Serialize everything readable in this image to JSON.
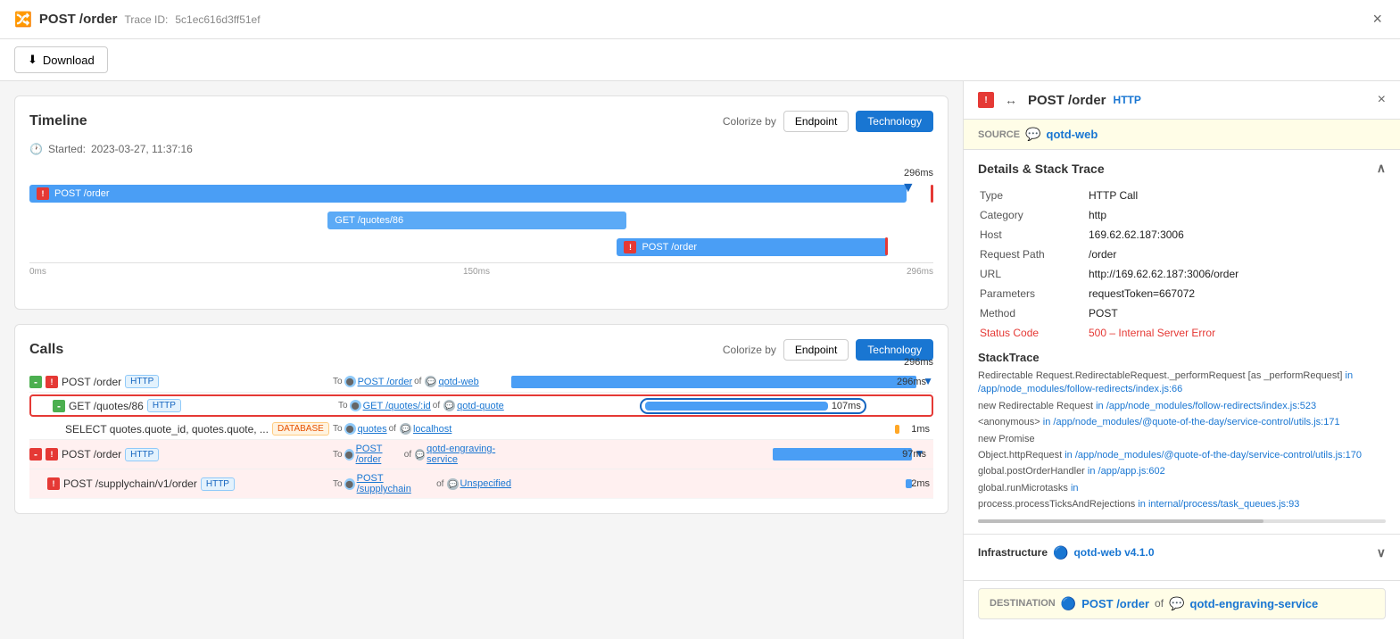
{
  "topbar": {
    "icon": "↔",
    "title": "POST /order",
    "trace_label": "Trace ID:",
    "trace_id": "5c1ec616d3ff51ef",
    "close_label": "×"
  },
  "download": {
    "button_label": "Download",
    "icon": "⬇"
  },
  "timeline": {
    "title": "Timeline",
    "colorize_label": "Colorize by",
    "endpoint_label": "Endpoint",
    "technology_label": "Technology",
    "started_label": "Started:",
    "started_value": "2023-03-27, 11:37:16",
    "end_time": "296ms",
    "bars": [
      {
        "label": "POST /order",
        "start_pct": 0,
        "width_pct": 97,
        "has_error": true,
        "arrow": true
      },
      {
        "label": "GET /quotes/86",
        "start_pct": 32,
        "width_pct": 34,
        "has_error": false,
        "arrow": false
      },
      {
        "label": "POST /order",
        "start_pct": 64,
        "width_pct": 30,
        "has_error": true,
        "arrow": false
      }
    ]
  },
  "calls": {
    "title": "Calls",
    "colorize_label": "Colorize by",
    "endpoint_label": "Endpoint",
    "technology_label": "Technology",
    "end_time": "296ms",
    "rows": [
      {
        "indent": 0,
        "collapse": "minus-green",
        "error": true,
        "name": "POST /order",
        "badge": "HTTP",
        "to": "POST /order",
        "of": "qotd-web",
        "bar_width_pct": 96,
        "bar_offset_pct": 0,
        "bar_color": "blue",
        "duration": "296ms",
        "has_arrow": true
      },
      {
        "indent": 1,
        "collapse": "minus-green",
        "error": false,
        "name": "GET /quotes/86",
        "badge": "HTTP",
        "to": "GET /quotes/:id",
        "of": "qotd-quote",
        "bar_width_pct": 50,
        "bar_offset_pct": 32,
        "bar_color": "blue",
        "duration": "107ms",
        "highlighted": true
      },
      {
        "indent": 2,
        "collapse": null,
        "error": false,
        "name": "SELECT quotes.quote_id, quotes.quote, ...",
        "badge": "DATABASE",
        "to": "quotes",
        "of": "localhost",
        "bar_width_pct": 1,
        "bar_offset_pct": 55,
        "bar_color": "orange",
        "duration": "1ms"
      },
      {
        "indent": 0,
        "collapse": "minus-red",
        "error": true,
        "name": "POST /order",
        "badge": "HTTP",
        "to": "POST /order",
        "of": "qotd-engraving-service",
        "bar_width_pct": 35,
        "bar_offset_pct": 61,
        "bar_color": "blue",
        "duration": "97ms",
        "has_arrow": true
      },
      {
        "indent": 1,
        "collapse": null,
        "error": true,
        "name": "POST /supplychain/v1/order",
        "badge": "HTTP",
        "to": "POST /supplychain",
        "of": "Unspecified",
        "bar_width_pct": 1.5,
        "bar_offset_pct": 95,
        "bar_color": "blue",
        "duration": "2ms"
      }
    ]
  },
  "detail_panel": {
    "error_icon": "!",
    "arrows": "↔",
    "title": "POST /order",
    "badge": "HTTP",
    "close": "×",
    "source_label": "SOURCE",
    "source_icon": "💬",
    "source_value": "qotd-web",
    "section_details_title": "Details & Stack Trace",
    "details": [
      {
        "key": "Type",
        "value": "HTTP Call"
      },
      {
        "key": "Category",
        "value": "http"
      },
      {
        "key": "Host",
        "value": "169.62.62.187:3006"
      },
      {
        "key": "Request Path",
        "value": "/order"
      },
      {
        "key": "URL",
        "value": "http://169.62.62.187:3006/order"
      },
      {
        "key": "Parameters",
        "value": "requestToken=667072"
      },
      {
        "key": "Method",
        "value": "POST"
      },
      {
        "key": "Status Code",
        "value": "500 – Internal Server Error",
        "error": true
      }
    ],
    "stack_trace_title": "StackTrace",
    "stack_lines": [
      {
        "method": "Redirectable Request.RedirectableRequest._performRequest [as _performRequest]",
        "path": "in /app/node_modules/follow-redirects/index.js:66"
      },
      {
        "method": "new RedirectableRequest",
        "path": "in /app/node_modules/follow-redirects/index.js:523"
      },
      {
        "method": "<anonymous>",
        "path": "in /app/node_modules/@quote-of-the-day/service-control/utils.js:171"
      },
      {
        "method": "new Promise",
        "path": ""
      },
      {
        "method": "Object.httpRequest",
        "path": "in /app/node_modules/@quote-of-the-day/service-control/utils.js:170"
      },
      {
        "method": "global.postOrderHandler",
        "path": "in /app/app.js:602"
      },
      {
        "method": "global.runMicrotasks",
        "path": "in"
      },
      {
        "method": "process.processTicksAndRejections",
        "path": "in internal/process/task_queues.js:93"
      }
    ],
    "infra_title": "Infrastructure",
    "infra_icon": "🔵",
    "infra_value": "qotd-web v4.1.0",
    "dest_label": "DESTINATION",
    "dest_icon": "🔵",
    "dest_text": "POST /order",
    "dest_of": "of",
    "dest_service_icon": "💬",
    "dest_service": "qotd-engraving-service"
  }
}
